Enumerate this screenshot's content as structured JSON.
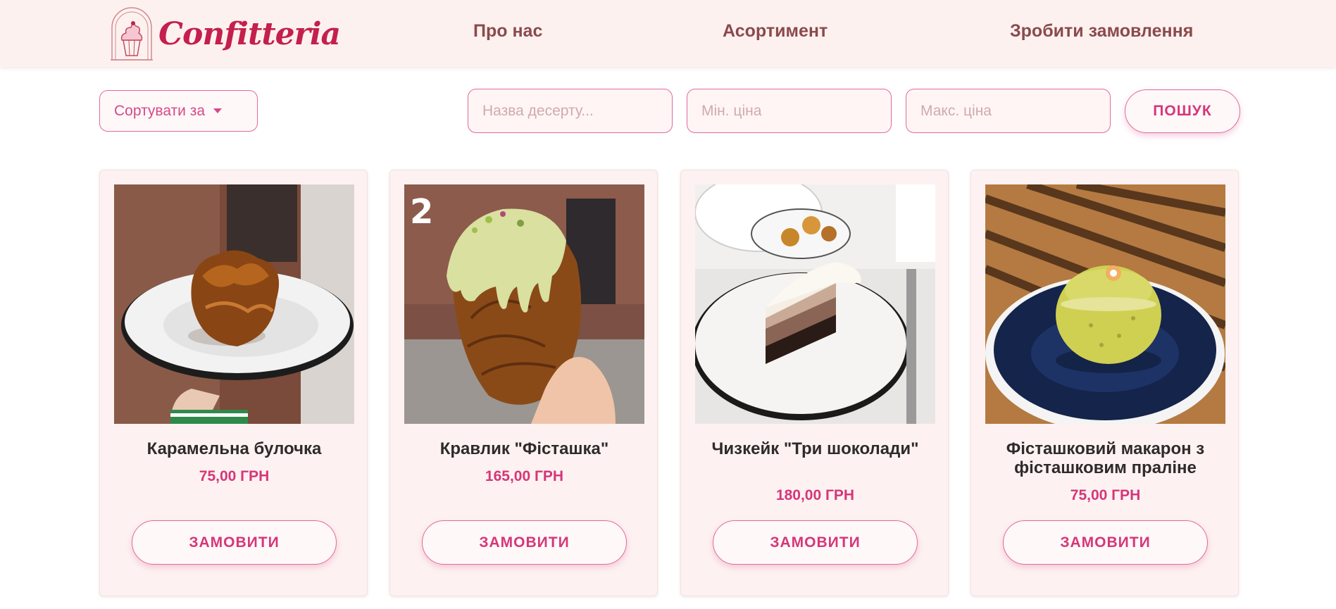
{
  "header": {
    "logo_text": "Confitteria",
    "nav": {
      "about": "Про нас",
      "assortment": "Асортимент",
      "order": "Зробити замовлення"
    }
  },
  "filters": {
    "sort_label": "Сортувати за",
    "name_placeholder": "Назва десерту...",
    "min_price_placeholder": "Мін. ціна",
    "max_price_placeholder": "Макс. ціна",
    "search_label": "ПОШУК"
  },
  "products": [
    {
      "title": "Карамельна булочка",
      "price": "75,00 ГРН",
      "button": "ЗАМОВИТИ"
    },
    {
      "title": "Кравлик \"Фісташка\"",
      "price": "165,00 ГРН",
      "button": "ЗАМОВИТИ"
    },
    {
      "title": "Чизкейк \"Три шоколади\"",
      "price": "180,00 ГРН",
      "button": "ЗАМОВИТИ"
    },
    {
      "title": "Фісташковий макарон з фісташковим праліне",
      "price": "75,00 ГРН",
      "button": "ЗАМОВИТИ"
    }
  ],
  "colors": {
    "header_bg": "#fdf1f0",
    "brand": "#c41f4d",
    "nav_text": "#8a4a4c",
    "accent": "#d6367a",
    "border": "#e06a9e",
    "card_bg": "#fdf2f1"
  },
  "icons": {
    "logo": "cupcake-icon",
    "sort": "caret-down-icon"
  }
}
